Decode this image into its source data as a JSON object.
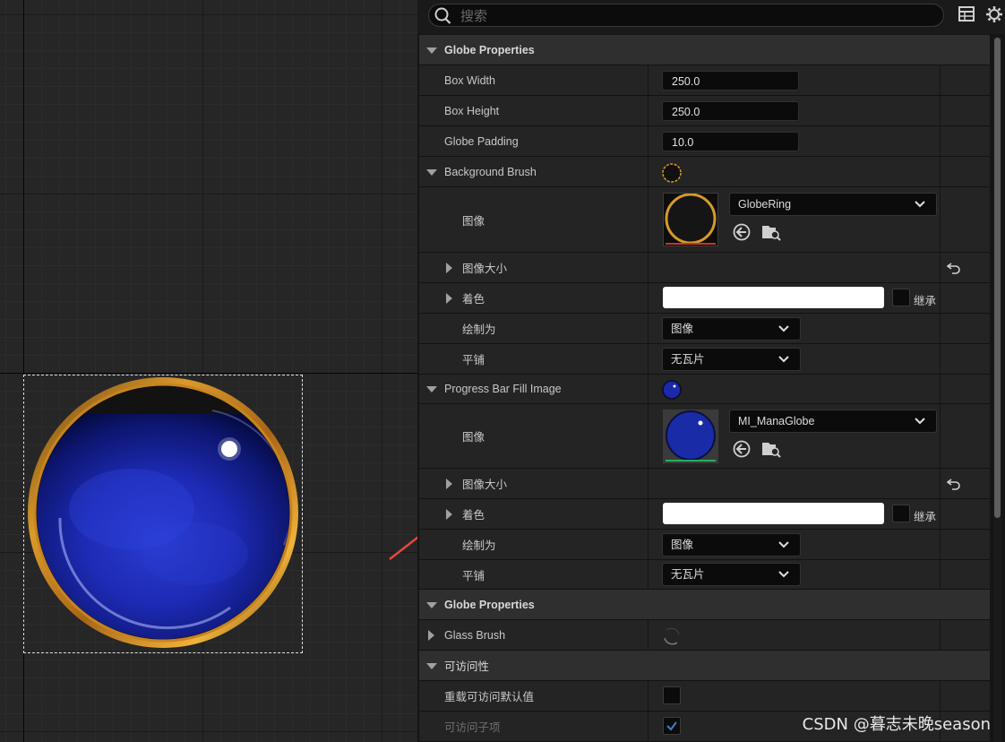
{
  "search": {
    "placeholder": "搜索"
  },
  "panel": {
    "globe_properties_1": "Globe Properties",
    "box_width": {
      "label": "Box Width",
      "value": "250.0"
    },
    "box_height": {
      "label": "Box Height",
      "value": "250.0"
    },
    "globe_padding": {
      "label": "Globe Padding",
      "value": "10.0"
    },
    "background_brush": {
      "label": "Background Brush",
      "image_label": "图像",
      "image_asset": "GlobeRing",
      "image_size_label": "图像大小",
      "tint_label": "着色",
      "inherit_label": "继承",
      "draw_as_label": "绘制为",
      "draw_as_value": "图像",
      "tiling_label": "平铺",
      "tiling_value": "无瓦片"
    },
    "progress_fill": {
      "label": "Progress Bar Fill Image",
      "image_label": "图像",
      "image_asset": "MI_ManaGlobe",
      "image_size_label": "图像大小",
      "tint_label": "着色",
      "inherit_label": "继承",
      "draw_as_label": "绘制为",
      "draw_as_value": "图像",
      "tiling_label": "平铺",
      "tiling_value": "无瓦片"
    },
    "globe_properties_2": "Globe Properties",
    "glass_brush": {
      "label": "Glass Brush"
    },
    "accessibility": {
      "label": "可访问性",
      "override_label": "重载可访问默认值",
      "children_label": "可访问子项"
    }
  },
  "watermark": "CSDN @暮志未晚season",
  "colors": {
    "accent_arrow": "#e8473b",
    "panel_bg": "#242424",
    "category_bg": "#2f2f2f",
    "checkbox_blue": "#3f7fc8"
  }
}
